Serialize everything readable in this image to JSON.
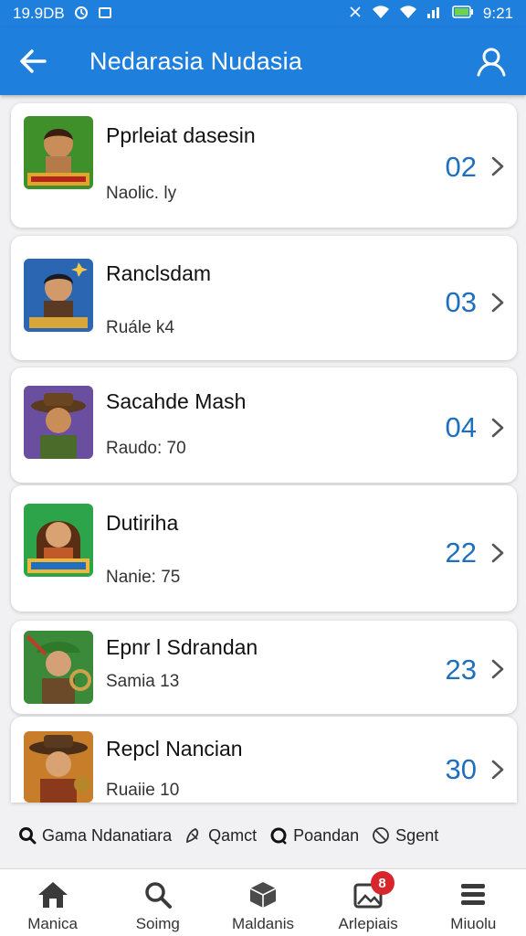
{
  "status_bar": {
    "time_left": "19.9DB",
    "time_right": "9:21"
  },
  "app_bar": {
    "title": "Nedarasia Nudasia",
    "back_icon": "arrow-left-icon",
    "profile_icon": "user-icon"
  },
  "items": [
    {
      "title": "Pprleiat dasesin",
      "subtitle": "Naolic. ly",
      "number": "02",
      "art": "jungle-heroine"
    },
    {
      "title": "Ranclsdam",
      "subtitle": "Ruále k4",
      "number": "03",
      "art": "hero-boy"
    },
    {
      "title": "Sacahde Mash",
      "subtitle": "Raudo: 70",
      "number": "04",
      "art": "explorer-hat"
    },
    {
      "title": "Dutiriha",
      "subtitle": "Nanie: 75",
      "number": "22",
      "art": "heroine-two"
    },
    {
      "title": "Epnr l Sdrandan",
      "subtitle": "Samia 13",
      "number": "23",
      "art": "green-hat-archer"
    },
    {
      "title": "Repcl Nancian",
      "subtitle": "Ruaiie 10",
      "number": "30",
      "art": "cowboy-girl"
    }
  ],
  "tags": [
    {
      "label": "Gama Ndanatiara",
      "icon": "search-icon"
    },
    {
      "label": "Qamct",
      "icon": "tag-icon"
    },
    {
      "label": "Poandan",
      "icon": "chat-icon"
    },
    {
      "label": "Sgent",
      "icon": "no-icon"
    }
  ],
  "bottom_nav": [
    {
      "label": "Manica",
      "icon": "home-icon"
    },
    {
      "label": "Soimg",
      "icon": "search-icon"
    },
    {
      "label": "Maldanis",
      "icon": "cube-icon"
    },
    {
      "label": "Arlepiais",
      "icon": "gallery-icon",
      "badge": "8"
    },
    {
      "label": "Miuolu",
      "icon": "menu-icon"
    }
  ],
  "colors": {
    "primary": "#1f7fdc",
    "number": "#1f6fc0",
    "badge": "#d9262c"
  }
}
